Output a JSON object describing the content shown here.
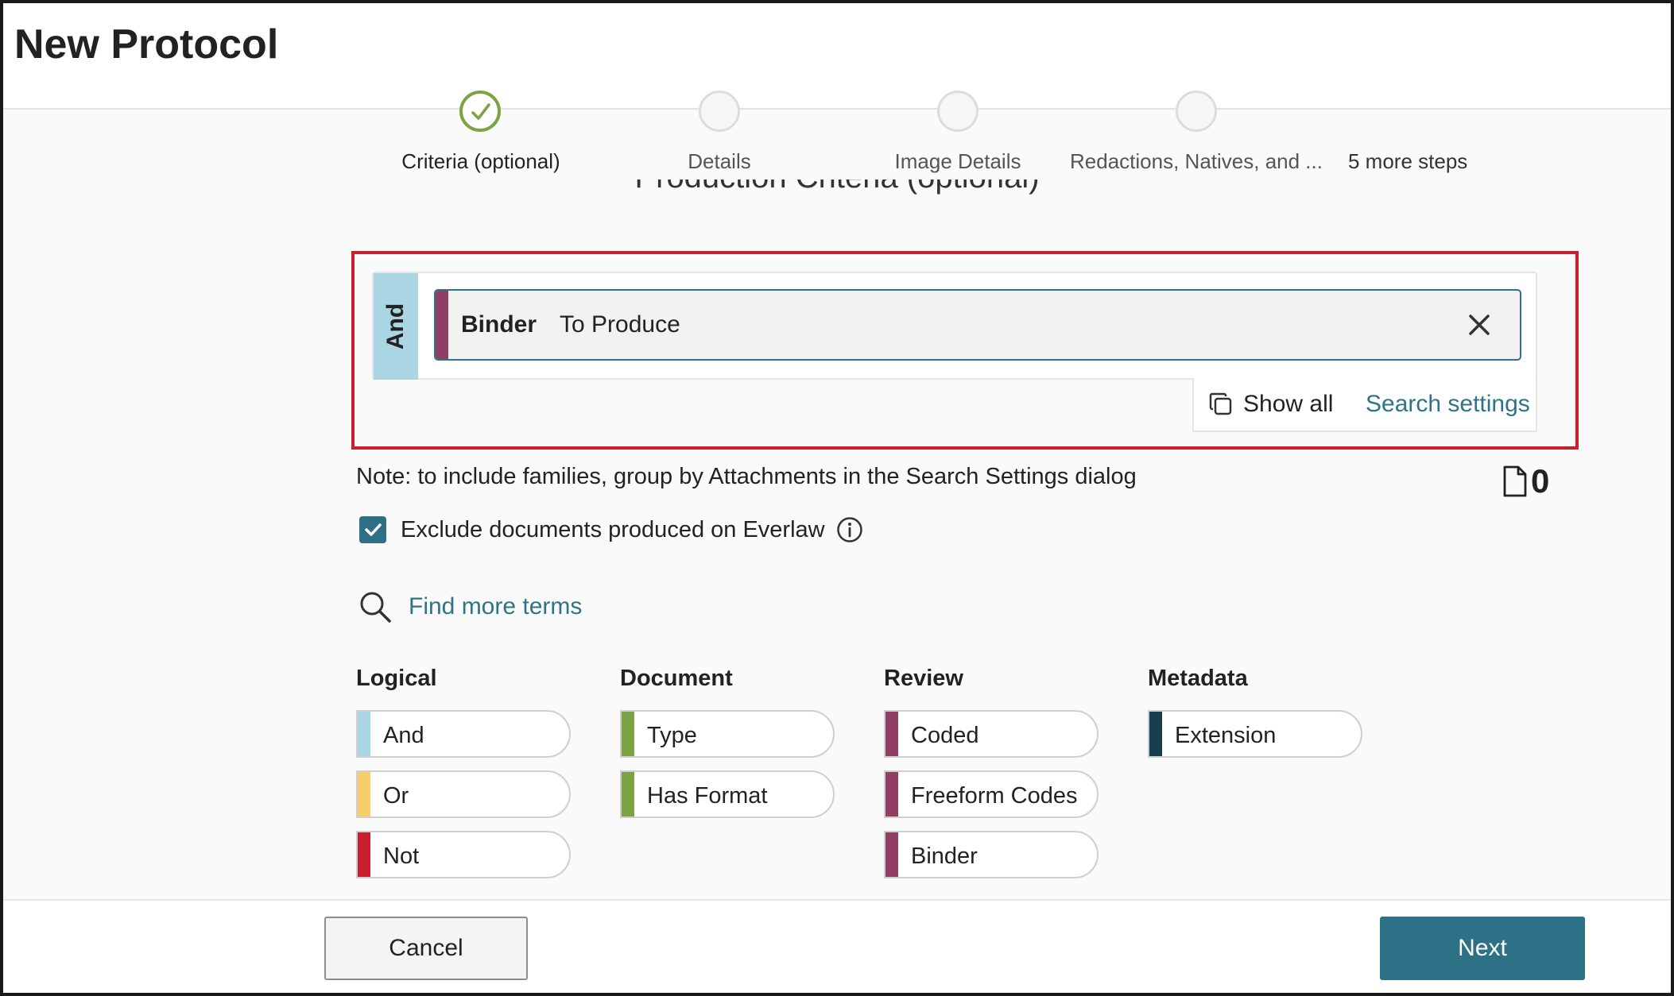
{
  "page_title": "New Protocol",
  "stepper": {
    "steps": [
      {
        "label": "Criteria (optional)",
        "state": "complete"
      },
      {
        "label": "Details",
        "state": "pending"
      },
      {
        "label": "Image Details",
        "state": "pending"
      },
      {
        "label": "Redactions, Natives, and ...",
        "state": "pending"
      }
    ],
    "more_steps": "5 more steps"
  },
  "section_title": "Production Criteria (optional)",
  "builder": {
    "group_operator": "And",
    "term": {
      "name": "Binder",
      "value": "To Produce",
      "color": "#8e3f63"
    },
    "remove_icon": "close-icon",
    "show_all_label": "Show all",
    "show_all_icon": "copy-icon",
    "search_settings_label": "Search settings"
  },
  "note": "Note: to include families, group by Attachments in the Search Settings dialog",
  "doc_count": {
    "icon": "document-icon",
    "value": "0"
  },
  "exclude_option": {
    "label": "Exclude documents produced on Everlaw",
    "checked": true,
    "info_icon": "info-icon"
  },
  "find_more": {
    "label": "Find more terms",
    "icon": "search-icon"
  },
  "palette": {
    "logical": {
      "heading": "Logical",
      "items": [
        {
          "label": "And",
          "color": "#a9d6e2"
        },
        {
          "label": "Or",
          "color": "#f6cf6b"
        },
        {
          "label": "Not",
          "color": "#c8202e"
        }
      ]
    },
    "document": {
      "heading": "Document",
      "items": [
        {
          "label": "Type",
          "color": "#7ba344"
        },
        {
          "label": "Has Format",
          "color": "#7ba344"
        }
      ]
    },
    "review": {
      "heading": "Review",
      "items": [
        {
          "label": "Coded",
          "color": "#8e3f63"
        },
        {
          "label": "Freeform Codes",
          "color": "#8e3f63"
        },
        {
          "label": "Binder",
          "color": "#8e3f63"
        }
      ]
    },
    "metadata": {
      "heading": "Metadata",
      "items": [
        {
          "label": "Extension",
          "color": "#173f4f"
        }
      ]
    }
  },
  "footer": {
    "cancel_label": "Cancel",
    "next_label": "Next"
  }
}
